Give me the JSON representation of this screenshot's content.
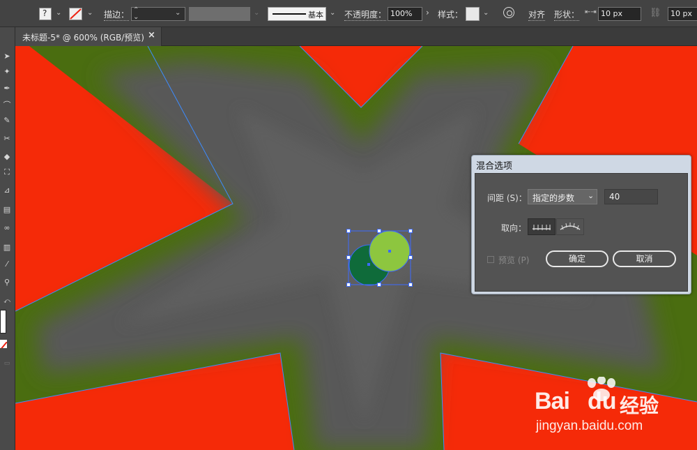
{
  "control_bar": {
    "stroke_label": "描边：",
    "profile_label": "基本",
    "opacity_label": "不透明度：",
    "opacity_value": "100%",
    "style_label": "样式：",
    "align_label": "对齐",
    "shape_label": "形状：",
    "width_value": "10 px",
    "height_value": "10 px"
  },
  "document_tab": {
    "title": "未标题-5* @ 600% (RGB/预览)",
    "close_glyph": "×"
  },
  "blend_dialog": {
    "title": "混合选项",
    "spacing_label": "间距 (S)：",
    "spacing_option": "指定的步数",
    "steps_value": "40",
    "orientation_label": "取向：",
    "preview_label": "预览 (P)",
    "ok_label": "确定",
    "cancel_label": "取消"
  },
  "watermark": {
    "brand_latin": "Bai",
    "brand_du": "du",
    "brand_cn": "经验",
    "url": "jingyan.baidu.com"
  },
  "colors": {
    "star_green": "#4a6d10",
    "star_gray": "#5a5a5a",
    "background_red": "#f52a08",
    "circle_dark": "#0f6b3a",
    "circle_light": "#8dc63f",
    "selection_blue": "#3d6bff"
  }
}
